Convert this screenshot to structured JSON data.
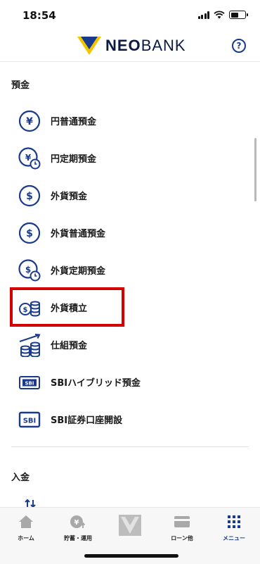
{
  "status": {
    "time": "18:54"
  },
  "header": {
    "logo_bold": "NEO",
    "logo_light": "BANK",
    "help_symbol": "?"
  },
  "sections": {
    "deposits_title": "預金",
    "deposit_in_title": "入金"
  },
  "menu": {
    "items": [
      {
        "label": "円普通預金",
        "icon": "yen-coin-icon"
      },
      {
        "label": "円定期預金",
        "icon": "yen-clock-icon"
      },
      {
        "label": "外貨預金",
        "icon": "dollar-coin-icon"
      },
      {
        "label": "外貨普通預金",
        "icon": "dollar-coin-icon"
      },
      {
        "label": "外貨定期預金",
        "icon": "dollar-clock-icon"
      },
      {
        "label": "外貨積立",
        "icon": "coin-stack-icon",
        "highlighted": true
      },
      {
        "label": "仕組預金",
        "icon": "growth-coins-icon"
      },
      {
        "label": "SBIハイブリッド預金",
        "icon": "sbi-card-icon",
        "badge": "SBI"
      },
      {
        "label": "SBI証券口座開設",
        "icon": "sbi-badge-icon",
        "badge": "SBI"
      }
    ]
  },
  "tabbar": {
    "home": "ホーム",
    "savings": "貯蓄・運用",
    "loans": "ローン他",
    "menu": "メニュー",
    "savings_badge": "¥"
  },
  "colors": {
    "brand_navy": "#1a3a8f",
    "brand_yellow": "#f5c400",
    "highlight_red": "#d40000"
  }
}
